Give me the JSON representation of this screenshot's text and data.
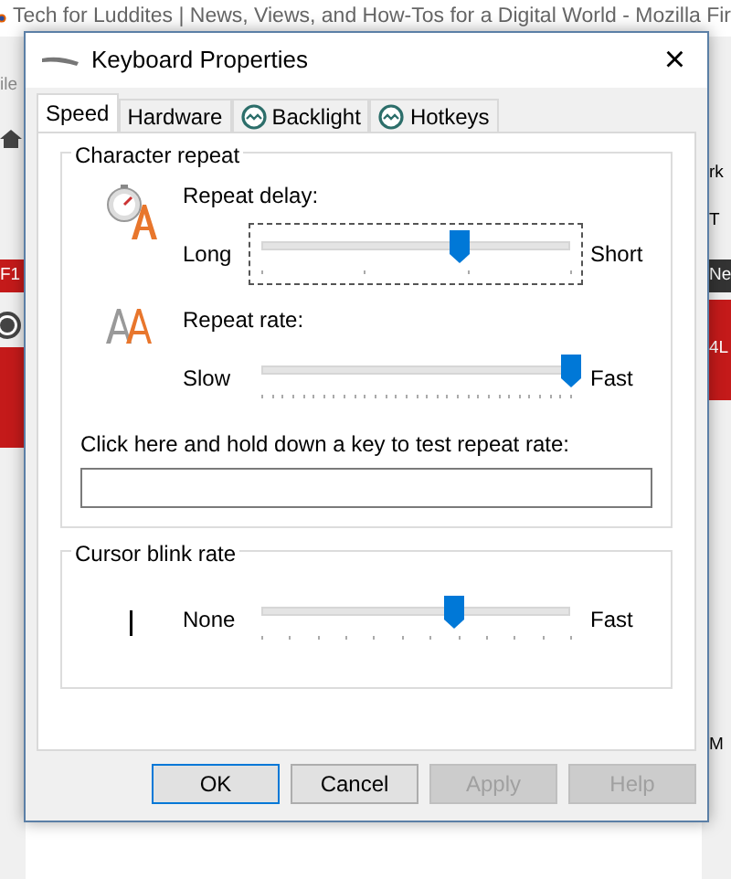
{
  "browser": {
    "title": "Tech for Luddites | News, Views, and How-Tos for a Digital World - Mozilla Fir",
    "left_fragments": [
      {
        "text": "ile",
        "kind": "menu"
      },
      {
        "text": "F1",
        "kind": "red"
      }
    ],
    "right_fragments": [
      {
        "text": "rk",
        "kind": "plain"
      },
      {
        "text": "T",
        "kind": "tab"
      },
      {
        "text": "Ne",
        "kind": "dark"
      },
      {
        "text": "4L",
        "kind": "red"
      },
      {
        "text": "M",
        "kind": "plain"
      }
    ]
  },
  "window": {
    "title": "Keyboard Properties",
    "close": "×"
  },
  "tabs": [
    {
      "label": "Speed",
      "selected": true,
      "kind": "plain"
    },
    {
      "label": "Hardware",
      "selected": false,
      "kind": "plain"
    },
    {
      "label": "Backlight",
      "selected": false,
      "kind": "icon"
    },
    {
      "label": "Hotkeys",
      "selected": false,
      "kind": "icon"
    }
  ],
  "groups": [
    {
      "title": "Character repeat",
      "rows": [
        {
          "kind": "delay",
          "label": "Repeat delay:",
          "low": "Long",
          "high": "Short",
          "level": 0.64,
          "focused": true
        },
        {
          "kind": "rate",
          "label": "Repeat rate:",
          "low": "Slow",
          "high": "Fast",
          "level": 1.0,
          "focused": false
        }
      ],
      "test": {
        "label": "Click here and hold down a key to test repeat rate:"
      }
    },
    {
      "title": "Cursor blink rate",
      "rows": [
        {
          "kind": "cursor",
          "low": "None",
          "high": "Fast",
          "level": 0.62,
          "focused": false
        }
      ]
    }
  ],
  "buttons": [
    {
      "label": "OK",
      "default": true,
      "disabled": false
    },
    {
      "label": "Cancel",
      "default": false,
      "disabled": false
    },
    {
      "label": "Apply",
      "default": false,
      "disabled": true
    },
    {
      "label": "Help",
      "default": false,
      "disabled": true
    }
  ]
}
